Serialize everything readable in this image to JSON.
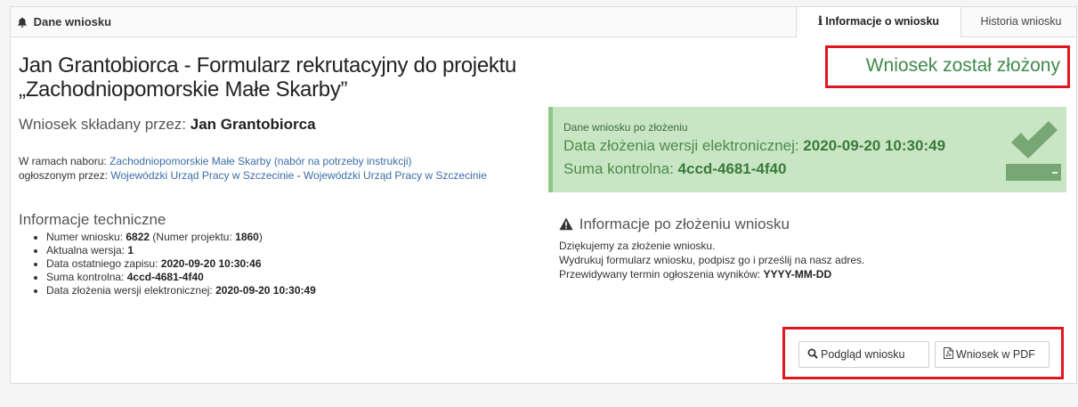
{
  "header": {
    "title": "Dane wniosku",
    "tabs": [
      "Informacje o wniosku",
      "Historia wniosku"
    ]
  },
  "main": {
    "title": "Jan Grantobiorca - Formularz rekrutacyjny do projektu „Zachodniopomorskie Małe Skarby”",
    "submitted_by_label": "Wniosek składany przez:",
    "submitted_by_name": "Jan Grantobiorca",
    "nabor_prefix": "W ramach naboru:",
    "nabor_link": "Zachodniopomorskie Małe Skarby (nabór na potrzeby instrukcji)",
    "announced_prefix": "ogłoszonym przez:",
    "announced_link1": "Wojewódzki Urząd Pracy w Szczecinie",
    "announced_sep": " - ",
    "announced_link2": "Wojewódzki Urząd Pracy w Szczecinie"
  },
  "tech": {
    "title": "Informacje techniczne",
    "number_label": "Numer wniosku:",
    "number_value": "6822",
    "project_open": "(Numer projektu:",
    "project_value": "1860",
    "project_close": ")",
    "version_label": "Aktualna wersja:",
    "version_value": "1",
    "lastsave_label": "Data ostatniego zapisu:",
    "lastsave_value": "2020-09-20 10:30:46",
    "checksum_label": "Suma kontrolna:",
    "checksum_value": "4ccd-4681-4f40",
    "elec_label": "Data złożenia wersji elektronicznej:",
    "elec_value": "2020-09-20 10:30:49"
  },
  "status": {
    "text": "Wniosek został złożony",
    "color": "#3f8a4a"
  },
  "submitted_box": {
    "small": "Dane wniosku po złożeniu",
    "date_label": "Data złożenia wersji elektronicznej:",
    "date_value": "2020-09-20 10:30:49",
    "checksum_label": "Suma kontrolna:",
    "checksum_value": "4ccd-4681-4f40"
  },
  "after": {
    "title": "Informacje po złożeniu wniosku",
    "line1": "Dziękujemy za złożenie wniosku.",
    "line2": "Wydrukuj formularz wniosku, podpisz go i prześlij na nasz adres.",
    "line3_label": "Przewidywany termin ogłoszenia wyników:",
    "line3_value": "YYYY-MM-DD"
  },
  "buttons": {
    "preview": "Podgląd wniosku",
    "pdf": "Wniosek w PDF"
  },
  "icons": {
    "header": "bell-icon",
    "tab": "info-icon",
    "check": "check-icon",
    "warning": "warning-icon",
    "search": "search-icon",
    "pdf": "pdf-file-icon"
  }
}
